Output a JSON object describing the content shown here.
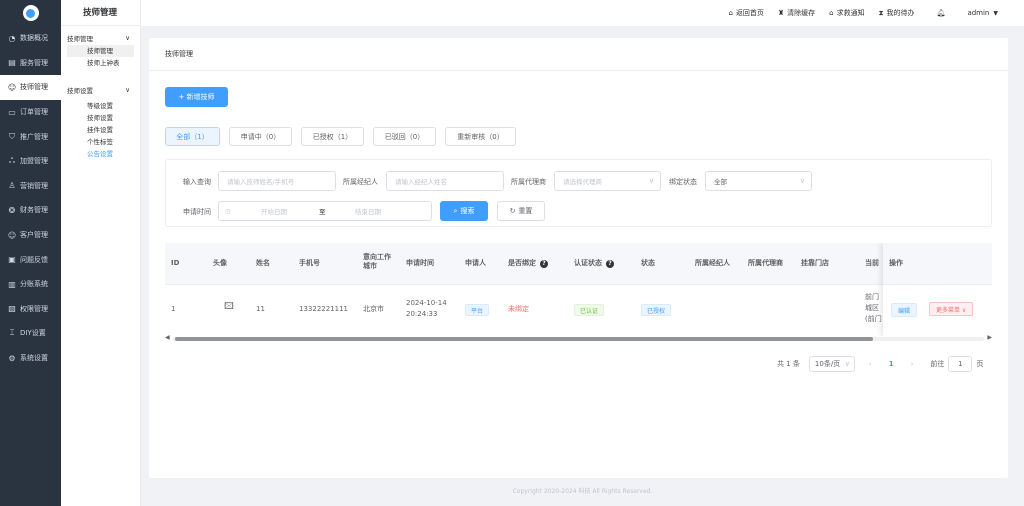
{
  "sidebar": {
    "items": [
      {
        "icon": "◔",
        "label": "数据概况"
      },
      {
        "icon": "▤",
        "label": "服务管理"
      },
      {
        "icon": "☺",
        "label": "技师管理",
        "active": true
      },
      {
        "icon": "▭",
        "label": "订单管理"
      },
      {
        "icon": "⛉",
        "label": "推广管理"
      },
      {
        "icon": "ஃ",
        "label": "加盟管理"
      },
      {
        "icon": "♙",
        "label": "营销管理"
      },
      {
        "icon": "❂",
        "label": "财务管理"
      },
      {
        "icon": "☺",
        "label": "客户管理"
      },
      {
        "icon": "▣",
        "label": "问题反馈"
      },
      {
        "icon": "▥",
        "label": "分账系统"
      },
      {
        "icon": "▧",
        "label": "权限管理"
      },
      {
        "icon": "⌶",
        "label": "DIY设置"
      },
      {
        "icon": "⚙",
        "label": "系统设置"
      }
    ]
  },
  "submenu": {
    "title": "技师管理",
    "group1": "技师管理",
    "group1_items": [
      "技师管理",
      "技师上钟表"
    ],
    "group2": "技师设置",
    "group2_items": [
      "等级设置",
      "技师设置",
      "挂件设置",
      "个性标签",
      "公告设置"
    ]
  },
  "header": {
    "home": "返回首页",
    "cache": "清除缓存",
    "notice": "求救通知",
    "todo": "我的待办",
    "user": "admin"
  },
  "breadcrumb": "技师管理",
  "add_button": "+ 新增技师",
  "tabs": [
    "全部（1）",
    "申请中（0）",
    "已授权（1）",
    "已驳回（0）",
    "重新审核（0）"
  ],
  "filter": {
    "label_query": "输入查询",
    "ph_query": "请输入技师姓名/手机号",
    "label_agent": "所属经纪人",
    "ph_agent": "请输入经纪人姓名",
    "label_proxy": "所属代理商",
    "ph_proxy": "请选择代理商",
    "label_bind": "绑定状态",
    "bind_value": "全部",
    "label_date": "申请时间",
    "ph_start": "开始日期",
    "sep": "至",
    "ph_end": "结束日期",
    "search": "搜索",
    "reset": "重置"
  },
  "table": {
    "headers": {
      "id": "ID",
      "avatar": "头像",
      "name": "姓名",
      "phone": "手机号",
      "city1": "意向工作",
      "city2": "城市",
      "time": "申请时间",
      "applicant": "申请人",
      "bound": "是否绑定",
      "auth": "认证状态",
      "status": "状态",
      "agent": "所属经纪人",
      "proxy": "所属代理商",
      "store": "挂靠门店",
      "current": "当前",
      "op": "操作"
    },
    "row": {
      "id": "1",
      "name": "11",
      "phone": "13322221111",
      "city": "北京市",
      "date": "2024-10-14",
      "time": "20:24:33",
      "applicant": "平台",
      "bound": "未绑定",
      "auth": "已认证",
      "status": "已授权",
      "cur1": "前门",
      "cur2": "城区",
      "cur3": "(前门",
      "edit": "编辑",
      "more": "更多菜单 ∨"
    }
  },
  "pager": {
    "total": "共 1 条",
    "size": "10条/页",
    "page": "1",
    "goto": "前往",
    "goto_val": "1",
    "unit": "页"
  },
  "footer": "Copyright 2020-2024 科技 All Rights Reserved."
}
